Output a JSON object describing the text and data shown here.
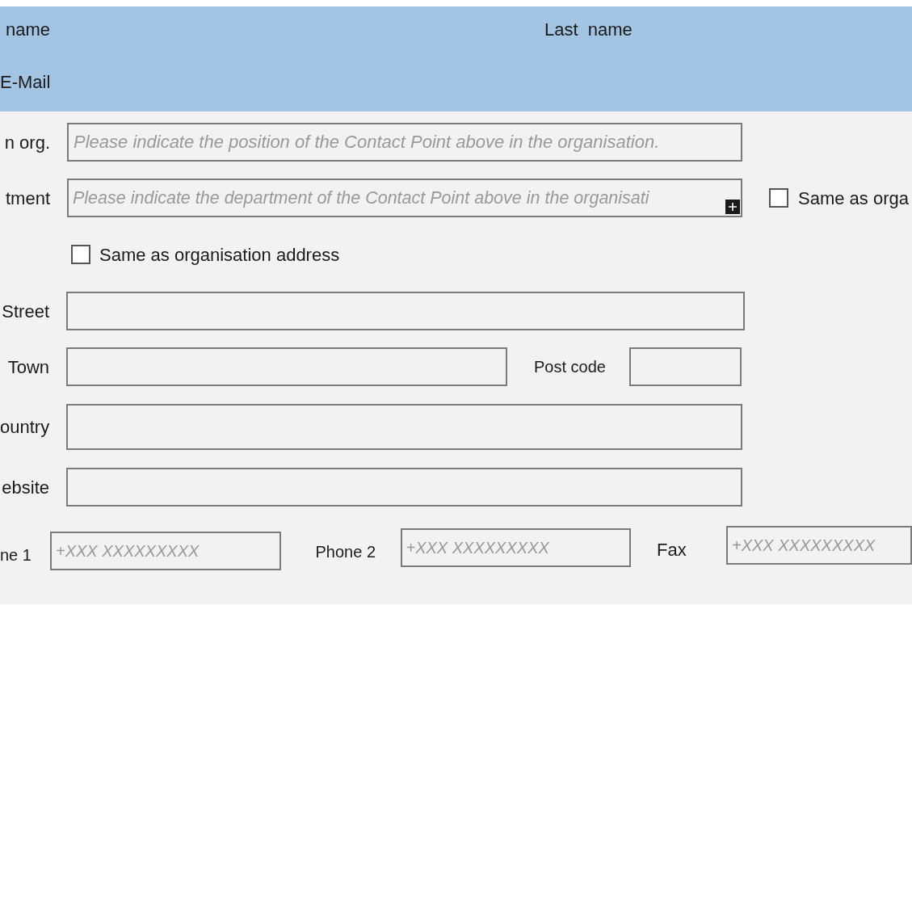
{
  "header": {
    "first_name_label": "name",
    "last_name_label": "Last  name",
    "email_label": "E-Mail"
  },
  "position": {
    "label": "n org.",
    "placeholder": "Please indicate the position of the Contact Point above in the organisation."
  },
  "department": {
    "label": "tment",
    "placeholder": "Please indicate the department of the Contact Point above in the organisati",
    "same_as_checkbox": {
      "label": "Same as orga",
      "checked": false
    }
  },
  "address": {
    "same_as_checkbox": {
      "label": "Same as organisation address",
      "checked": false
    },
    "street": {
      "label": "Street"
    },
    "town": {
      "label": "Town"
    },
    "post_code": {
      "label": "Post code"
    },
    "country": {
      "label": "ountry"
    },
    "website": {
      "label": "ebsite"
    }
  },
  "phones": [
    {
      "label": "ne 1",
      "placeholder": "+XXX XXXXXXXXX"
    },
    {
      "label": "Phone 2",
      "placeholder": "+XXX XXXXXXXXX"
    },
    {
      "label": "Fax",
      "placeholder": "+XXX XXXXXXXXX"
    }
  ]
}
